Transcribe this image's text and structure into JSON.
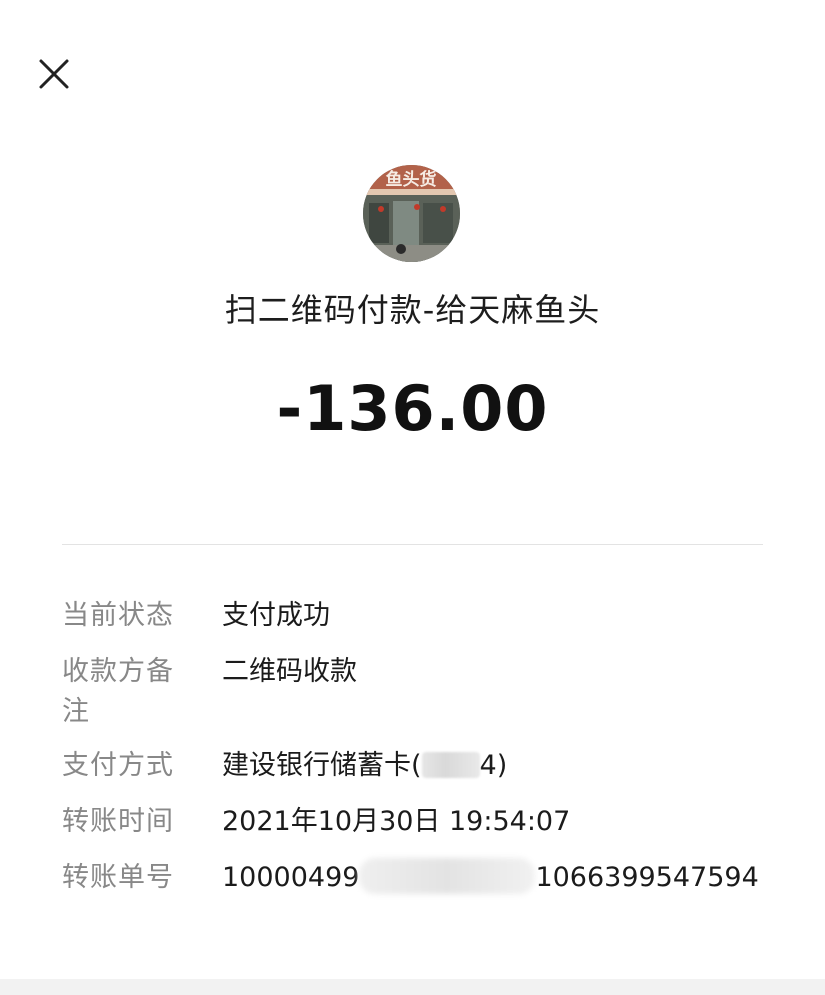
{
  "merchant": {
    "title": "扫二维码付款-给天麻鱼头",
    "avatar_sign_text": "鱼头货"
  },
  "transaction": {
    "amount": "-136.00"
  },
  "details": [
    {
      "label": "当前状态",
      "value": "支付成功"
    },
    {
      "label_line1": "收款方备",
      "label_line2": "注",
      "value": "二维码收款"
    },
    {
      "label": "支付方式",
      "value_prefix": "建设银行储蓄卡(",
      "value_suffix": "4)"
    },
    {
      "label": "转账时间",
      "value": "2021年10月30日 19:54:07"
    },
    {
      "label": "转账单号",
      "value_prefix": "10000499",
      "value_suffix": "1066399547594"
    }
  ],
  "icons": {
    "close": "close-icon"
  }
}
